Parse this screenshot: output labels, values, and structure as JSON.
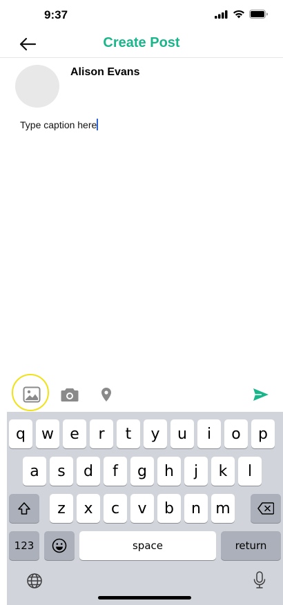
{
  "status_bar": {
    "time": "9:37",
    "icons": [
      "signal-icon",
      "wifi-icon",
      "battery-icon"
    ]
  },
  "header": {
    "back_icon": "arrow-left-icon",
    "title": "Create Post",
    "title_color": "#1bb58c"
  },
  "composer": {
    "author_name": "Alison Evans",
    "avatar_icon": "avatar-placeholder",
    "caption_placeholder": "Type caption here",
    "caption_value": "Type caption here"
  },
  "toolbar": {
    "items": [
      "image-icon",
      "camera-icon",
      "location-pin-icon",
      "send-icon"
    ],
    "send_color": "#1bb58c",
    "highlight_color": "#f0e219"
  },
  "keyboard": {
    "row1": [
      "q",
      "w",
      "e",
      "r",
      "t",
      "y",
      "u",
      "i",
      "o",
      "p"
    ],
    "row2": [
      "a",
      "s",
      "d",
      "f",
      "g",
      "h",
      "j",
      "k",
      "l"
    ],
    "row3": [
      "z",
      "x",
      "c",
      "v",
      "b",
      "n",
      "m"
    ],
    "shift_icon": "shift-icon",
    "delete_icon": "backspace-icon",
    "numbers_label": "123",
    "emoji_icon": "emoji-icon",
    "space_label": "space",
    "return_label": "return",
    "globe_icon": "globe-icon",
    "mic_icon": "microphone-icon"
  }
}
